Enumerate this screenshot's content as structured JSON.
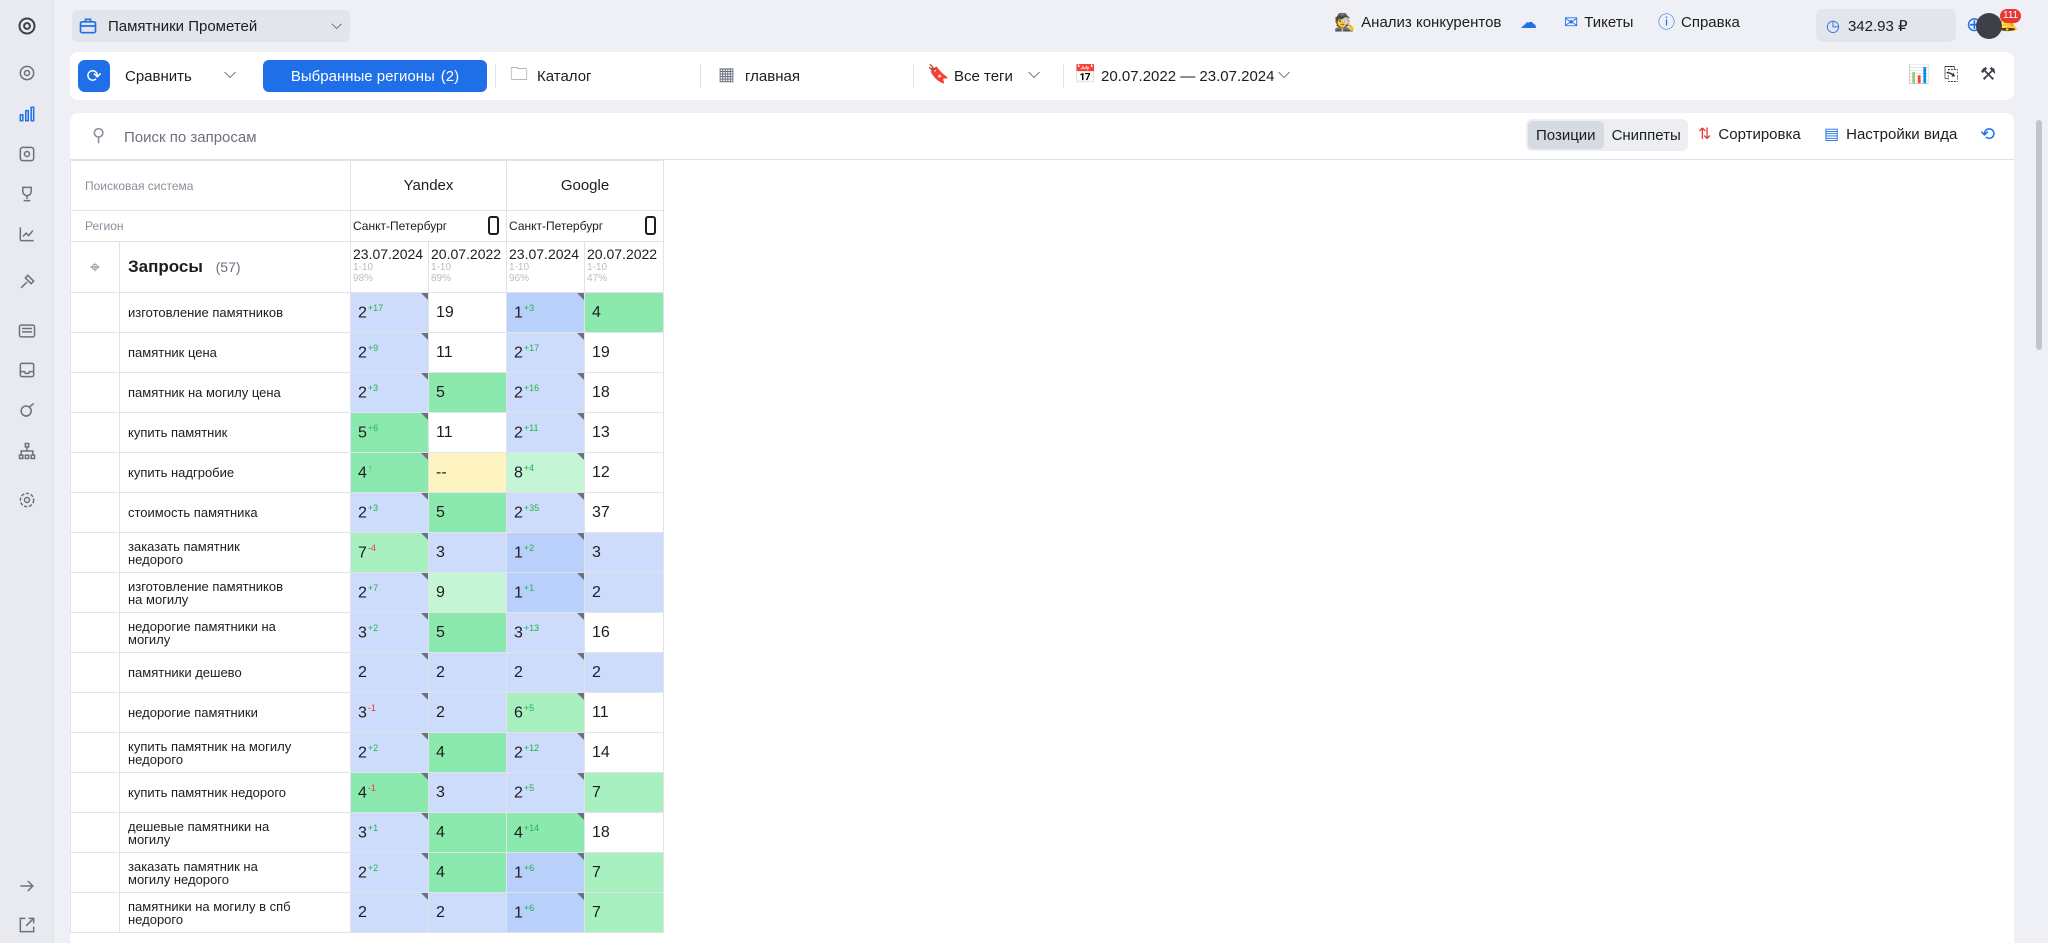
{
  "header": {
    "project_name": "Памятники Прометей",
    "competitors_label": "Анализ конкурентов",
    "tickets_label": "Тикеты",
    "help_label": "Справка",
    "balance": "342.93 ₽",
    "notifications_count": "111"
  },
  "toolbar": {
    "compare_label": "Сравнить",
    "regions_label": "Выбранные регионы",
    "regions_count": "(2)",
    "catalog_label": "Каталог",
    "group_label": "главная",
    "tags_label": "Все теги",
    "date_range": "20.07.2022 — 23.07.2024"
  },
  "search": {
    "placeholder": "Поиск по запросам",
    "tab_positions": "Позиции",
    "tab_snippets": "Сниппеты",
    "sort_label": "Сортировка",
    "view_settings_label": "Настройки вида"
  },
  "table": {
    "engine_row_label": "Поисковая система",
    "region_row_label": "Регион",
    "queries_label": "Запросы",
    "queries_count": "(57)",
    "engines": [
      {
        "name": "Yandex",
        "region": "Санкт-Петербург"
      },
      {
        "name": "Google",
        "region": "Санкт-Петербург"
      }
    ],
    "date_columns": [
      {
        "date": "23.07.2024",
        "top": "1-10",
        "pct": "98%"
      },
      {
        "date": "20.07.2022",
        "top": "1-10",
        "pct": "89%"
      },
      {
        "date": "23.07.2024",
        "top": "1-10",
        "pct": "96%"
      },
      {
        "date": "20.07.2022",
        "top": "1-10",
        "pct": "47%"
      }
    ],
    "rows": [
      {
        "q1": "изготовление памятников",
        "q2": "",
        "cells": [
          {
            "v": "2",
            "d": "+17",
            "c": "blue",
            "k": 1
          },
          {
            "v": "19",
            "d": "",
            "c": "white",
            "k": 0
          },
          {
            "v": "1",
            "d": "+3",
            "c": "blue2",
            "k": 1
          },
          {
            "v": "4",
            "d": "",
            "c": "green",
            "k": 0
          }
        ]
      },
      {
        "q1": "памятник цена",
        "q2": "",
        "cells": [
          {
            "v": "2",
            "d": "+9",
            "c": "blue",
            "k": 1
          },
          {
            "v": "11",
            "d": "",
            "c": "white",
            "k": 0
          },
          {
            "v": "2",
            "d": "+17",
            "c": "blue",
            "k": 1
          },
          {
            "v": "19",
            "d": "",
            "c": "white",
            "k": 0
          }
        ]
      },
      {
        "q1": "памятник на могилу цена",
        "q2": "",
        "cells": [
          {
            "v": "2",
            "d": "+3",
            "c": "blue",
            "k": 1
          },
          {
            "v": "5",
            "d": "",
            "c": "green",
            "k": 0
          },
          {
            "v": "2",
            "d": "+16",
            "c": "blue",
            "k": 1
          },
          {
            "v": "18",
            "d": "",
            "c": "white",
            "k": 0
          }
        ]
      },
      {
        "q1": "купить памятник",
        "q2": "",
        "cells": [
          {
            "v": "5",
            "d": "+6",
            "c": "green",
            "k": 1
          },
          {
            "v": "11",
            "d": "",
            "c": "white",
            "k": 0
          },
          {
            "v": "2",
            "d": "+11",
            "c": "blue",
            "k": 1
          },
          {
            "v": "13",
            "d": "",
            "c": "white",
            "k": 0
          }
        ]
      },
      {
        "q1": "купить надгробие",
        "q2": "",
        "cells": [
          {
            "v": "4",
            "d": "↑",
            "c": "green",
            "k": 1
          },
          {
            "v": "--",
            "d": "",
            "c": "yellow",
            "k": 0
          },
          {
            "v": "8",
            "d": "+4",
            "c": "green3",
            "k": 1
          },
          {
            "v": "12",
            "d": "",
            "c": "white",
            "k": 0
          }
        ]
      },
      {
        "q1": "стоимость памятника",
        "q2": "",
        "cells": [
          {
            "v": "2",
            "d": "+3",
            "c": "blue",
            "k": 1
          },
          {
            "v": "5",
            "d": "",
            "c": "green",
            "k": 0
          },
          {
            "v": "2",
            "d": "+35",
            "c": "blue",
            "k": 1
          },
          {
            "v": "37",
            "d": "",
            "c": "white",
            "k": 0
          }
        ]
      },
      {
        "q1": "заказать памятник",
        "q2": "недорого",
        "cells": [
          {
            "v": "7",
            "d": "-4",
            "c": "green2",
            "k": 1
          },
          {
            "v": "3",
            "d": "",
            "c": "blue",
            "k": 0
          },
          {
            "v": "1",
            "d": "+2",
            "c": "blue2",
            "k": 1
          },
          {
            "v": "3",
            "d": "",
            "c": "blue",
            "k": 0
          }
        ]
      },
      {
        "q1": "изготовление памятников",
        "q2": "на могилу",
        "cells": [
          {
            "v": "2",
            "d": "+7",
            "c": "blue",
            "k": 1
          },
          {
            "v": "9",
            "d": "",
            "c": "green3",
            "k": 0
          },
          {
            "v": "1",
            "d": "+1",
            "c": "blue2",
            "k": 1
          },
          {
            "v": "2",
            "d": "",
            "c": "blue",
            "k": 0
          }
        ]
      },
      {
        "q1": "недорогие памятники на",
        "q2": "могилу",
        "cells": [
          {
            "v": "3",
            "d": "+2",
            "c": "blue",
            "k": 1
          },
          {
            "v": "5",
            "d": "",
            "c": "green",
            "k": 0
          },
          {
            "v": "3",
            "d": "+13",
            "c": "blue",
            "k": 1
          },
          {
            "v": "16",
            "d": "",
            "c": "white",
            "k": 0
          }
        ]
      },
      {
        "q1": "памятники дешево",
        "q2": "",
        "cells": [
          {
            "v": "2",
            "d": "",
            "c": "blue",
            "k": 1
          },
          {
            "v": "2",
            "d": "",
            "c": "blue",
            "k": 0
          },
          {
            "v": "2",
            "d": "",
            "c": "blue",
            "k": 1
          },
          {
            "v": "2",
            "d": "",
            "c": "blue",
            "k": 0
          }
        ]
      },
      {
        "q1": "недорогие памятники",
        "q2": "",
        "cells": [
          {
            "v": "3",
            "d": "-1",
            "c": "blue",
            "k": 1
          },
          {
            "v": "2",
            "d": "",
            "c": "blue",
            "k": 0
          },
          {
            "v": "6",
            "d": "+5",
            "c": "green2",
            "k": 1
          },
          {
            "v": "11",
            "d": "",
            "c": "white",
            "k": 0
          }
        ]
      },
      {
        "q1": "купить памятник на могилу",
        "q2": "недорого",
        "cells": [
          {
            "v": "2",
            "d": "+2",
            "c": "blue",
            "k": 1
          },
          {
            "v": "4",
            "d": "",
            "c": "green",
            "k": 0
          },
          {
            "v": "2",
            "d": "+12",
            "c": "blue",
            "k": 1
          },
          {
            "v": "14",
            "d": "",
            "c": "white",
            "k": 0
          }
        ]
      },
      {
        "q1": "купить памятник недорого",
        "q2": "",
        "cells": [
          {
            "v": "4",
            "d": "-1",
            "c": "green",
            "k": 1
          },
          {
            "v": "3",
            "d": "",
            "c": "blue",
            "k": 0
          },
          {
            "v": "2",
            "d": "+5",
            "c": "blue",
            "k": 1
          },
          {
            "v": "7",
            "d": "",
            "c": "green2",
            "k": 0
          }
        ]
      },
      {
        "q1": "дешевые памятники на",
        "q2": "могилу",
        "cells": [
          {
            "v": "3",
            "d": "+1",
            "c": "blue",
            "k": 1
          },
          {
            "v": "4",
            "d": "",
            "c": "green",
            "k": 0
          },
          {
            "v": "4",
            "d": "+14",
            "c": "green",
            "k": 1
          },
          {
            "v": "18",
            "d": "",
            "c": "white",
            "k": 0
          }
        ]
      },
      {
        "q1": "заказать памятник на",
        "q2": "могилу недорого",
        "cells": [
          {
            "v": "2",
            "d": "+2",
            "c": "blue",
            "k": 1
          },
          {
            "v": "4",
            "d": "",
            "c": "green",
            "k": 0
          },
          {
            "v": "1",
            "d": "+6",
            "c": "blue2",
            "k": 1
          },
          {
            "v": "7",
            "d": "",
            "c": "green2",
            "k": 0
          }
        ]
      },
      {
        "q1": "памятники на могилу в спб",
        "q2": "недорого",
        "cells": [
          {
            "v": "2",
            "d": "",
            "c": "blue",
            "k": 1
          },
          {
            "v": "2",
            "d": "",
            "c": "blue",
            "k": 0
          },
          {
            "v": "1",
            "d": "+6",
            "c": "blue2",
            "k": 1
          },
          {
            "v": "7",
            "d": "",
            "c": "green2",
            "k": 0
          }
        ]
      }
    ]
  },
  "colors": {
    "accent": "#1e6fe8",
    "cell_blue": "#cddcfa",
    "cell_green": "#8ce9ad",
    "cell_yellow": "#fdf4c2",
    "badge_red": "#e53935"
  },
  "icons": [
    "logo-icon",
    "projects-icon",
    "positions-icon",
    "competitors-icon",
    "trophy-icon",
    "trend-icon",
    "tools-icon",
    "serp-icon",
    "inbox-icon",
    "audit-icon",
    "sitemap-icon",
    "settings-icon",
    "collapse-icon",
    "external-icon"
  ]
}
